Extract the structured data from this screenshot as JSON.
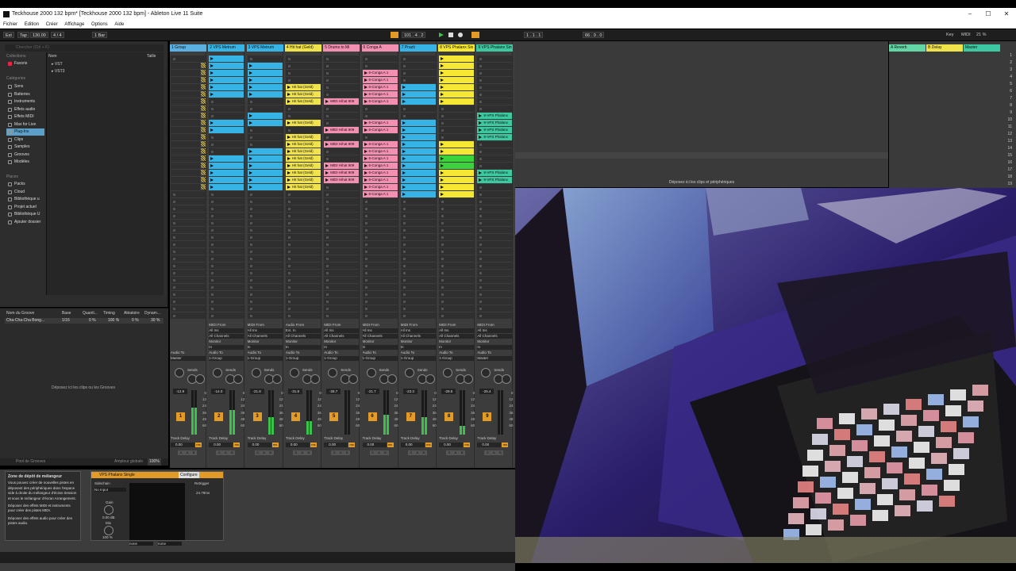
{
  "window": {
    "title": "Teckhouse 2000 132 bpm* [Teckhouse 2000 132 bpm] - Ableton Live 11 Suite",
    "min": "–",
    "max": "☐",
    "close": "✕"
  },
  "menu": [
    "Fichier",
    "Edition",
    "Créer",
    "Affichage",
    "Options",
    "Aide"
  ],
  "control": {
    "ext": "Ext",
    "tap": "Tap",
    "tempo": "130.00",
    "sig": "4 / 4",
    "bar": "1 Bar",
    "pos": "101 . 4 . 2",
    "pos2": "1 . 1 . 1",
    "loop": "66 . 0 . 0",
    "key": "Key",
    "midi": "MIDI",
    "cpu": "21 %"
  },
  "browser": {
    "search": "Chercher (Ctrl + F)",
    "collections": "Collections",
    "favoris": "Favoris",
    "categories_head": "Catégories",
    "categories": [
      "Sons",
      "Batteries",
      "Instruments",
      "Effets audio",
      "Effets MIDI",
      "Max for Live",
      "Plug-Ins",
      "Clips",
      "Samples",
      "Grooves",
      "Modèles"
    ],
    "places_head": "Places",
    "places": [
      "Packs",
      "Cloud",
      "Bibliothèque u",
      "Projet actuel",
      "Bibliothèque U",
      "Ajouter dossier"
    ],
    "col_name": "Nom",
    "col_size": "Taille",
    "items": [
      "VST",
      "VST3"
    ]
  },
  "groove": {
    "headers": [
      "Nom du Groove",
      "Base",
      "Quanti...",
      "Timing",
      "Aléatoire",
      "Dynam..."
    ],
    "row": [
      "Cha-Cha-Cha Bong...",
      "1/16",
      "0 %",
      "100 %",
      "0 %",
      "30 %"
    ],
    "drop": "Déposez ici les clips ou les Grooves",
    "footer": "Pool de Grooves",
    "global": "Ampleur globale",
    "global_val": "100%"
  },
  "tracks": [
    {
      "name": "1 Group",
      "color": "#5ab0e0",
      "vol": "-12.9",
      "num": "1",
      "meter": 0.6
    },
    {
      "name": "2 VPS Metrum",
      "color": "#36b4e6",
      "vol": "-14.0",
      "num": "2",
      "meter": 0.55
    },
    {
      "name": "3 VPS Metrum",
      "color": "#36b4e6",
      "vol": "-21.8",
      "num": "3",
      "meter": 0.4
    },
    {
      "name": "4 Hit hat (Geld)",
      "color": "#f0e24a",
      "vol": "-31.8",
      "num": "4",
      "meter": 0.3
    },
    {
      "name": "5 Drums to Mi",
      "color": "#f38fb0",
      "vol": "-28.7",
      "num": "5",
      "meter": 0.0
    },
    {
      "name": "6 Conga A",
      "color": "#f38fb0",
      "vol": "-21.7",
      "num": "6",
      "meter": 0.45
    },
    {
      "name": "7 Prazti",
      "color": "#36b4e6",
      "vol": "-23.3",
      "num": "7",
      "meter": 0.4
    },
    {
      "name": "8 VPS Phalanx Sin",
      "color": "#f5e732",
      "vol": "-29.5",
      "num": "8",
      "meter": 0.2
    },
    {
      "name": "9 VPS Phalanx Sin",
      "color": "#3cc8a0",
      "vol": "-25.4",
      "num": "9",
      "meter": 0.0
    }
  ],
  "clips": {
    "hithat": "Hit hat (Geld)",
    "midihat": "MIDI Hihat 909",
    "conga": "6-Conga A 1",
    "phalanx": "9-VPS Phalanx"
  },
  "mixer": {
    "midi_from": "MIDI From",
    "all_ins": "All Ins",
    "all_channels": "All Channels",
    "monitor": "Monitor",
    "in": "In",
    "auto": "Auto",
    "off": "Off",
    "audio_to": "Audio To",
    "group": "1-Group",
    "master": "Master",
    "audio_from": "Audio From",
    "ext_in": "Ext. In",
    "sends": "Sends",
    "track_delay": "Track Delay",
    "td_val": "0.00",
    "ms": "ms",
    "scale": [
      "0",
      "12",
      "24",
      "36",
      "48",
      "60"
    ]
  },
  "returns": [
    {
      "name": "A Reverb",
      "color": "#63d6a6"
    },
    {
      "name": "B Delay",
      "color": "#f0e24a"
    },
    {
      "name": "Master",
      "color": "#3cc8a0"
    }
  ],
  "scenes": [
    "1",
    "2",
    "3",
    "4",
    "5",
    "6",
    "7",
    "8",
    "9",
    "10",
    "11",
    "12",
    "13",
    "14",
    "15",
    "16",
    "17",
    "18",
    "19"
  ],
  "dropmsg": "Déposez ici les clips et périphériques",
  "zone": {
    "title": "Zone de dépôt de mélangeur",
    "p1": "Vous pouvez créer de nouvelles pistes en déposant des périphériques dans l'espace vide à droite du mélangeur d'écran Session et sous le mélangeur d'écran Arrangement.",
    "p2": "Déposez des effets MIDI et instruments pour créer des pistes MIDI.",
    "p3": "Déposez des effets audio pour créer des pistes audio."
  },
  "device": {
    "name": "VPS Phalanx Single",
    "configure": "Configure",
    "sidechain": "Sidechain",
    "no_input": "No Input",
    "gain": "Gain",
    "gain_val": "0.00 dB",
    "mix": "Mix",
    "mix_val": "100 %",
    "retrigger": "Retrigger",
    "retrig_val": "24.79ms",
    "none1": "none",
    "none2": "none"
  }
}
